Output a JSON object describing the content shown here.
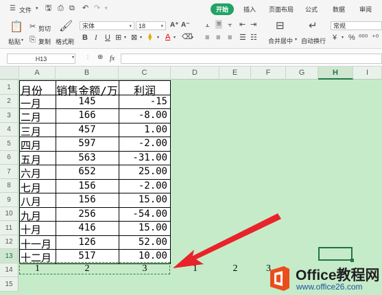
{
  "ribbon": {
    "file_label": "文件",
    "tabs": [
      "开始",
      "插入",
      "页面布局",
      "公式",
      "数据",
      "审阅"
    ],
    "active_tab_index": 0,
    "paste_label": "粘贴",
    "cut_label": "剪切",
    "copy_label": "复制",
    "format_painter_label": "格式刷",
    "font_name": "宋体",
    "font_size": "18",
    "merge_center_label": "合并居中",
    "wrap_label": "自动换行",
    "number_format": "常规"
  },
  "formula_bar": {
    "name_box": "H13",
    "fx_label": "fx",
    "formula": ""
  },
  "sheet": {
    "columns": [
      "A",
      "B",
      "C",
      "D",
      "E",
      "F",
      "G",
      "H",
      "I"
    ],
    "selected_column": "H",
    "rows": [
      "1",
      "2",
      "3",
      "4",
      "5",
      "6",
      "7",
      "8",
      "9",
      "10",
      "11",
      "12",
      "13",
      "14",
      "15"
    ],
    "selected_row": "13",
    "header": [
      "月份",
      "销售金额/万",
      "利润"
    ],
    "data": [
      [
        "一月",
        "145",
        "-15"
      ],
      [
        "二月",
        "166",
        "-8.00"
      ],
      [
        "三月",
        "457",
        "1.00"
      ],
      [
        "四月",
        "597",
        "-2.00"
      ],
      [
        "五月",
        "563",
        "-31.00"
      ],
      [
        "六月",
        "652",
        "25.00"
      ],
      [
        "七月",
        "156",
        "-2.00"
      ],
      [
        "八月",
        "156",
        "15.00"
      ],
      [
        "九月",
        "256",
        "-54.00"
      ],
      [
        "十月",
        "416",
        "15.00"
      ],
      [
        "十一月",
        "126",
        "52.00"
      ],
      [
        "十二月",
        "517",
        "10.00"
      ]
    ],
    "row14": [
      "1",
      "2",
      "3",
      "1",
      "2",
      "3"
    ]
  },
  "watermark": {
    "title": "Office教程网",
    "url": "www.office26.com"
  },
  "colors": {
    "sheet_bg": "#c6ebc9",
    "accent": "#21a366",
    "arrow": "#e8232a",
    "logo_orange": "#e94e1b"
  }
}
